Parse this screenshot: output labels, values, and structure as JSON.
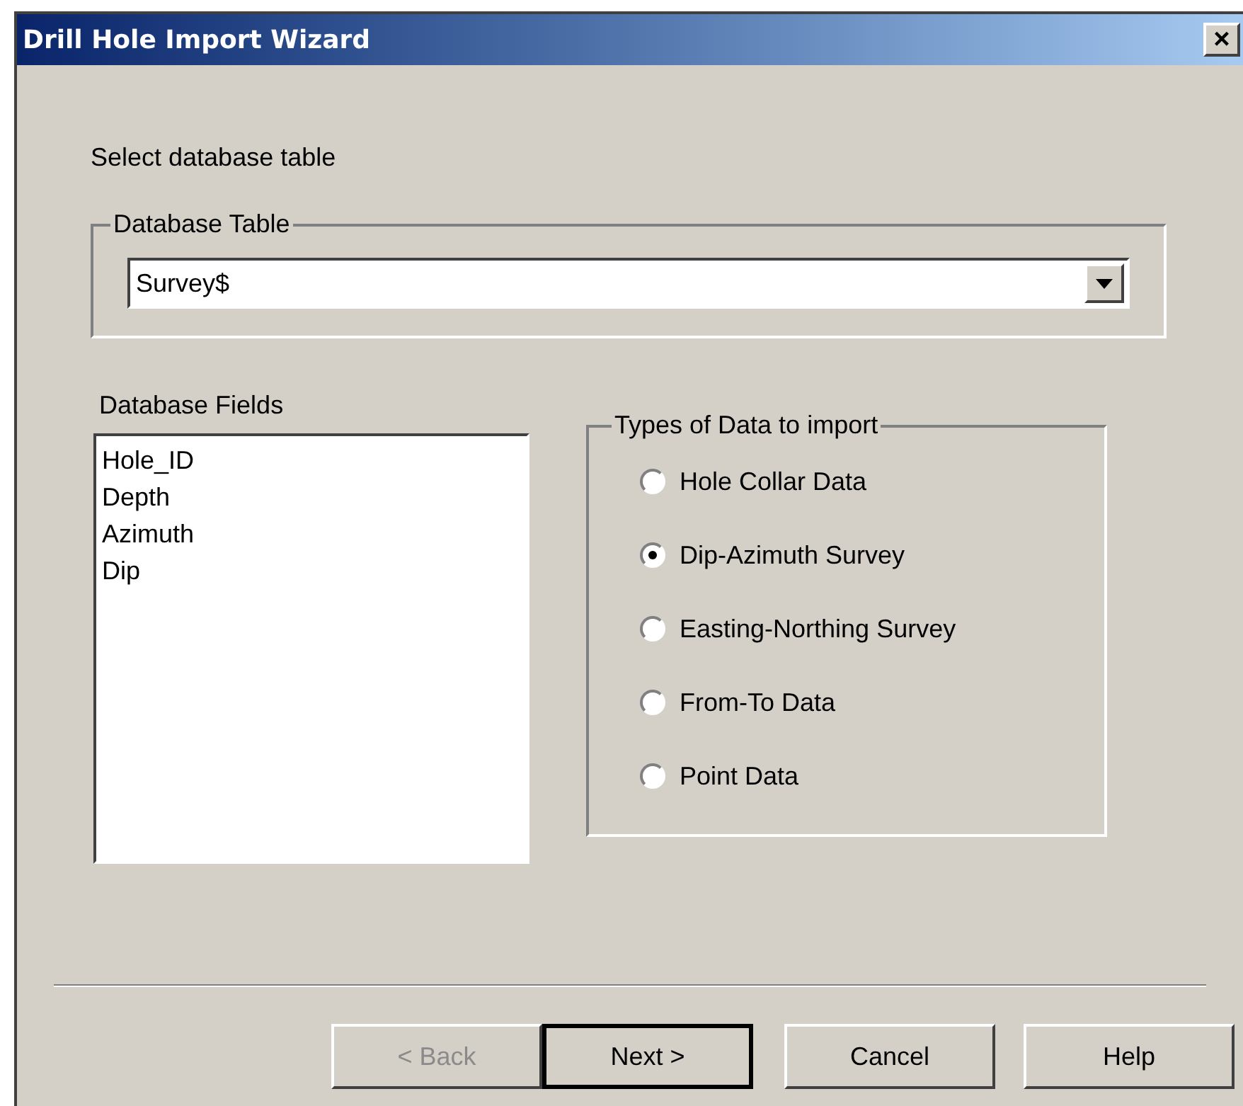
{
  "window": {
    "title": "Drill Hole Import Wizard",
    "close": "×"
  },
  "prompt": "Select database table",
  "database_table": {
    "legend": "Database Table",
    "value": "Survey$"
  },
  "database_fields": {
    "label": "Database Fields",
    "items": [
      "Hole_ID",
      "Depth",
      "Azimuth",
      "Dip"
    ]
  },
  "types_of_data": {
    "legend": "Types of Data to import",
    "options": [
      {
        "label": "Hole Collar Data",
        "selected": false
      },
      {
        "label": "Dip-Azimuth Survey",
        "selected": true
      },
      {
        "label": "Easting-Northing Survey",
        "selected": false
      },
      {
        "label": "From-To Data",
        "selected": false
      },
      {
        "label": "Point Data",
        "selected": false
      }
    ]
  },
  "buttons": [
    {
      "label": "< Back",
      "disabled": true,
      "default": false
    },
    {
      "label": "Next >",
      "disabled": false,
      "default": true
    },
    {
      "label": "Cancel",
      "disabled": false,
      "default": false
    },
    {
      "label": "Help",
      "disabled": false,
      "default": false
    }
  ]
}
